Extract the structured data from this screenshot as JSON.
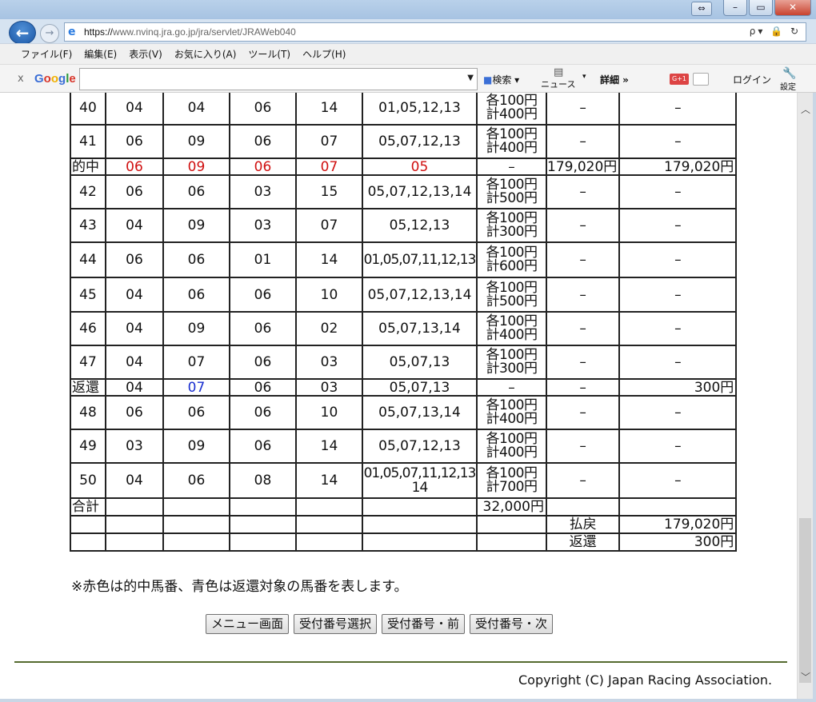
{
  "browser": {
    "url_prefix": "https://",
    "url_host": "www.nvinq.jra.go.jp",
    "url_path": "/jra/servlet/JRAWeb040",
    "addr_tools": "ρ▾ 🔒 ↻",
    "menu": [
      "ファイル(F)",
      "編集(E)",
      "表示(V)",
      "お気に入り(A)",
      "ツール(T)",
      "ヘルプ(H)"
    ],
    "google": {
      "close": "x",
      "logo": "Google",
      "search_button": "検索",
      "news_button": "ニュース",
      "details_button": "詳細 »",
      "gplus": "G+1",
      "login": "ログイン",
      "settings": "設定"
    }
  },
  "table": {
    "rows": [
      {
        "kind": "bet",
        "id": "40",
        "c1": "04",
        "c2": "04",
        "c3": "06",
        "c4": "14",
        "c5": "01,05,12,13",
        "amt1": "各100円",
        "amt2": "計400円",
        "c7": "–",
        "c8": "–"
      },
      {
        "kind": "bet",
        "id": "41",
        "c1": "06",
        "c2": "09",
        "c3": "06",
        "c4": "07",
        "c5": "05,07,12,13",
        "amt1": "各100円",
        "amt2": "計400円",
        "c7": "–",
        "c8": "–"
      },
      {
        "kind": "hit",
        "id": "的中",
        "c1": "06",
        "c2": "09",
        "c3": "06",
        "c4": "07",
        "c5": "05",
        "amt": "–",
        "c7": "179,020円",
        "c8": "179,020円"
      },
      {
        "kind": "bet",
        "id": "42",
        "c1": "06",
        "c2": "06",
        "c3": "03",
        "c4": "15",
        "c5": "05,07,12,13,14",
        "amt1": "各100円",
        "amt2": "計500円",
        "c7": "–",
        "c8": "–"
      },
      {
        "kind": "bet",
        "id": "43",
        "c1": "04",
        "c2": "09",
        "c3": "03",
        "c4": "07",
        "c5": "05,12,13",
        "amt1": "各100円",
        "amt2": "計300円",
        "c7": "–",
        "c8": "–"
      },
      {
        "kind": "bet",
        "id": "44",
        "c1": "06",
        "c2": "06",
        "c3": "01",
        "c4": "14",
        "c5": "01,05,07,11,12,13",
        "amt1": "各100円",
        "amt2": "計600円",
        "c7": "–",
        "c8": "–"
      },
      {
        "kind": "bet",
        "id": "45",
        "c1": "04",
        "c2": "06",
        "c3": "06",
        "c4": "10",
        "c5": "05,07,12,13,14",
        "amt1": "各100円",
        "amt2": "計500円",
        "c7": "–",
        "c8": "–"
      },
      {
        "kind": "bet",
        "id": "46",
        "c1": "04",
        "c2": "09",
        "c3": "06",
        "c4": "02",
        "c5": "05,07,13,14",
        "amt1": "各100円",
        "amt2": "計400円",
        "c7": "–",
        "c8": "–"
      },
      {
        "kind": "bet",
        "id": "47",
        "c1": "04",
        "c2": "07",
        "c3": "06",
        "c4": "03",
        "c5": "05,07,13",
        "amt1": "各100円",
        "amt2": "計300円",
        "c7": "–",
        "c8": "–"
      },
      {
        "kind": "refund",
        "id": "返還",
        "c1": "04",
        "c2": "07",
        "c3": "06",
        "c4": "03",
        "c5": "05,07,13",
        "amt": "–",
        "c7": "–",
        "c8": "300円"
      },
      {
        "kind": "bet",
        "id": "48",
        "c1": "06",
        "c2": "06",
        "c3": "06",
        "c4": "10",
        "c5": "05,07,13,14",
        "amt1": "各100円",
        "amt2": "計400円",
        "c7": "–",
        "c8": "–"
      },
      {
        "kind": "bet",
        "id": "49",
        "c1": "03",
        "c2": "09",
        "c3": "06",
        "c4": "14",
        "c5": "05,07,12,13",
        "amt1": "各100円",
        "amt2": "計400円",
        "c7": "–",
        "c8": "–"
      },
      {
        "kind": "bet",
        "id": "50",
        "c1": "04",
        "c2": "06",
        "c3": "08",
        "c4": "14",
        "c5": "01,05,07,11,12,13",
        "c5b": "14",
        "amt1": "各100円",
        "amt2": "計700円",
        "c7": "–",
        "c8": "–"
      }
    ],
    "total_label": "合計",
    "total_amount": "32,000円",
    "payout_label": "払戻",
    "payout_amount": "179,020円",
    "refund_label": "返還",
    "refund_amount": "300円"
  },
  "note": "※赤色は的中馬番、青色は返還対象の馬番を表します。",
  "buttons": {
    "menu": "メニュー画面",
    "select": "受付番号選択",
    "prev": "受付番号・前",
    "next": "受付番号・次"
  },
  "copyright": "Copyright (C) Japan Racing Association.",
  "colors": {
    "hit": "#d01010",
    "refund": "#1a2fd0",
    "rule": "#556b2f"
  }
}
